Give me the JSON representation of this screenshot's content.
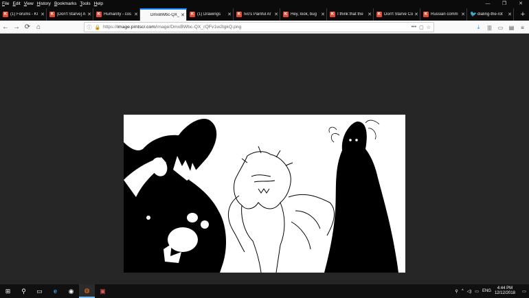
{
  "menu": [
    "File",
    "Edit",
    "View",
    "History",
    "Bookmarks",
    "Tools",
    "Help"
  ],
  "window_controls": {
    "minimize": "—",
    "maximize": "❐",
    "close": "✕"
  },
  "tabs": [
    {
      "title": "(1) Forums - Kl",
      "favicon": "K",
      "fav_type": "klei"
    },
    {
      "title": "[Don't Starve] A",
      "favicon": "K",
      "fav_type": "klei"
    },
    {
      "title": "Humanity - cos",
      "favicon": "K",
      "fav_type": "klei"
    },
    {
      "title": "DmxBWbc-QX_",
      "favicon": "",
      "fav_type": "blank",
      "active": true
    },
    {
      "title": "(1) Drawings",
      "favicon": "K",
      "fav_type": "klei"
    },
    {
      "title": "Ivo's Painful Ar",
      "favicon": "K",
      "fav_type": "klei"
    },
    {
      "title": "Hey, look, bug",
      "favicon": "K",
      "fav_type": "klei"
    },
    {
      "title": "I think that the",
      "favicon": "K",
      "fav_type": "klei"
    },
    {
      "title": "Don't Starve Co",
      "favicon": "K",
      "fav_type": "klei"
    },
    {
      "title": "Russian comm",
      "favicon": "K",
      "fav_type": "klei"
    },
    {
      "title": "dialing-the-rot",
      "favicon": "🐦",
      "fav_type": "tw"
    }
  ],
  "new_tab_label": "+",
  "nav": {
    "back": "←",
    "forward": "→",
    "reload": "⟳",
    "home": "⌂"
  },
  "url": {
    "prefix": "https://",
    "host": "image.prntscr.com",
    "path": "/image/DmxBWbc-QX_rQFv1w2tgkQ.png"
  },
  "url_actions": [
    "•••",
    "▢",
    "☆"
  ],
  "toolbar_right": [
    "⤓",
    "|||",
    "▭",
    "▤",
    "≡"
  ],
  "taskbar": {
    "start": "⊞",
    "search": "⚲",
    "apps": [
      "▭",
      "e",
      "◉",
      "◍",
      "▣"
    ]
  },
  "tray": {
    "icons": [
      "⚲",
      "^",
      "◁)",
      "▭"
    ],
    "lang": "ENG",
    "time": "4:44 PM",
    "date": "12/12/2018"
  }
}
